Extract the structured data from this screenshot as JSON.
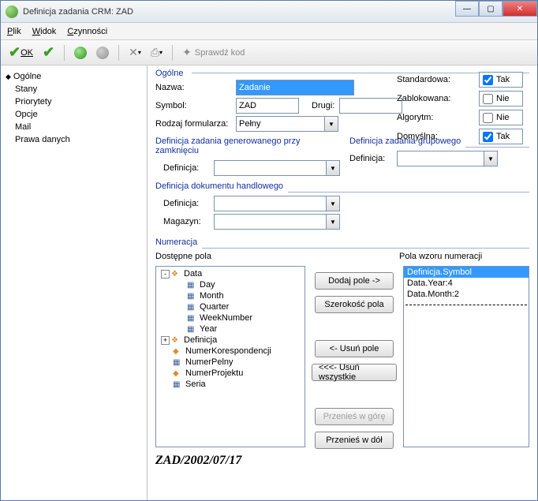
{
  "window": {
    "title": "Definicja zadania CRM: ZAD"
  },
  "menu": {
    "file": "Plik",
    "view": "Widok",
    "actions": "Czynności"
  },
  "toolbar": {
    "ok": "OK",
    "verify": "Sprawdź kod"
  },
  "sidebar": {
    "items": [
      {
        "label": "Ogólne",
        "selected": true
      },
      {
        "label": "Stany"
      },
      {
        "label": "Priorytety"
      },
      {
        "label": "Opcje"
      },
      {
        "label": "Mail"
      },
      {
        "label": "Prawa danych"
      }
    ]
  },
  "general": {
    "title": "Ogólne",
    "name_label": "Nazwa:",
    "name_value": "Zadanie",
    "symbol_label": "Symbol:",
    "symbol_value": "ZAD",
    "second_label": "Drugi:",
    "second_value": "",
    "formtype_label": "Rodzaj formularza:",
    "formtype_value": "Pełny",
    "flags": {
      "standard_label": "Standardowa:",
      "standard_value": "Tak",
      "standard_checked": true,
      "locked_label": "Zablokowana:",
      "locked_value": "Nie",
      "locked_checked": false,
      "algo_label": "Algorytm:",
      "algo_value": "Nie",
      "algo_checked": false,
      "default_label": "Domyślna:",
      "default_value": "Tak",
      "default_checked": true
    }
  },
  "closedef": {
    "title": "Definicja zadania generowanego przy zamknięciu",
    "def_label": "Definicja:",
    "def_value": ""
  },
  "groupdef": {
    "title": "Definicja zadania grupowego",
    "def_label": "Definicja:",
    "def_value": ""
  },
  "tradedoc": {
    "title": "Definicja dokumentu handlowego",
    "def_label": "Definicja:",
    "def_value": "",
    "mag_label": "Magazyn:",
    "mag_value": ""
  },
  "numbering": {
    "title": "Numeracja",
    "available_label": "Dostępne pola",
    "pattern_label": "Pola wzoru numeracji",
    "tree": [
      {
        "label": "Data",
        "level": 0,
        "icon": "diamond2",
        "expander": "-"
      },
      {
        "label": "Day",
        "level": 1,
        "icon": "field"
      },
      {
        "label": "Month",
        "level": 1,
        "icon": "field"
      },
      {
        "label": "Quarter",
        "level": 1,
        "icon": "field"
      },
      {
        "label": "WeekNumber",
        "level": 1,
        "icon": "field"
      },
      {
        "label": "Year",
        "level": 1,
        "icon": "field"
      },
      {
        "label": "Definicja",
        "level": 0,
        "icon": "diamond2",
        "expander": "+"
      },
      {
        "label": "NumerKorespondencji",
        "level": 0,
        "icon": "diamond"
      },
      {
        "label": "NumerPelny",
        "level": 0,
        "icon": "field"
      },
      {
        "label": "NumerProjektu",
        "level": 0,
        "icon": "diamond"
      },
      {
        "label": "Seria",
        "level": 0,
        "icon": "field"
      }
    ],
    "buttons": {
      "add": "Dodaj pole ->",
      "width": "Szerokość pola",
      "remove": "<- Usuń pole",
      "remove_all": "<<<- Usuń wszystkie",
      "move_up": "Przenieś w górę",
      "move_down": "Przenieś w dół"
    },
    "pattern": [
      {
        "label": "Definicja.Symbol",
        "selected": true
      },
      {
        "label": "Data.Year:4"
      },
      {
        "label": "Data.Month:2"
      }
    ],
    "preview": "ZAD/2002/07/17"
  }
}
